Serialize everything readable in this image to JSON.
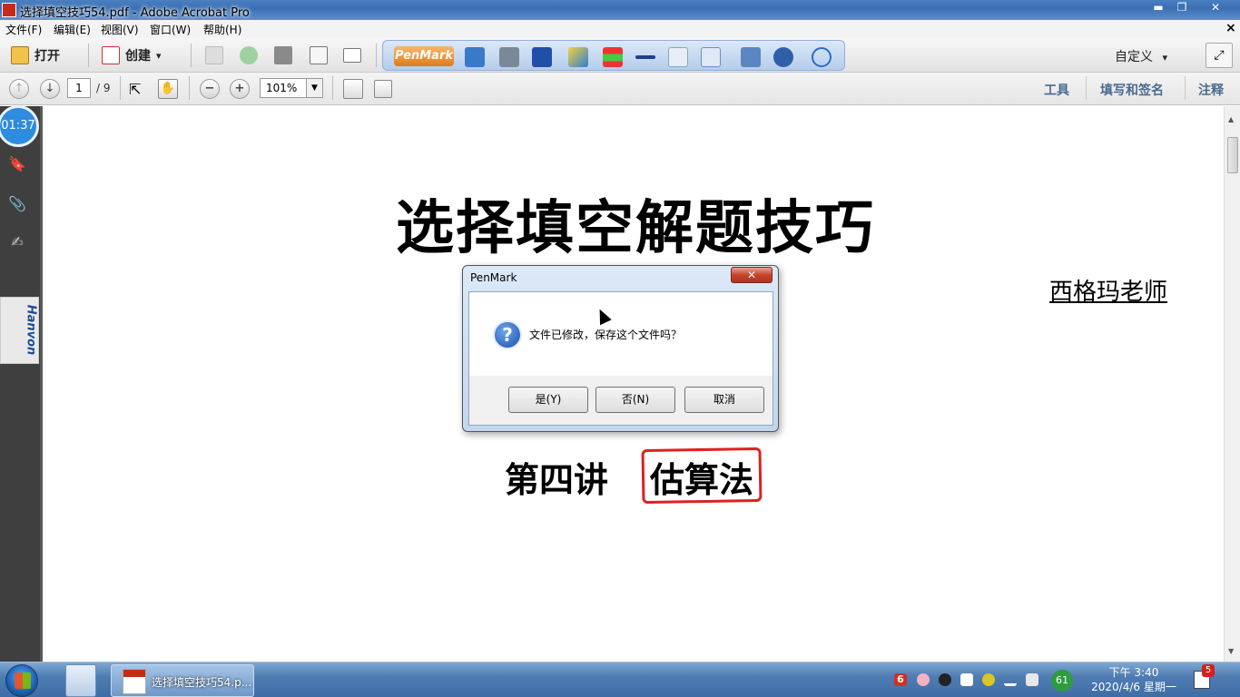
{
  "window": {
    "title": "选择填空技巧54.pdf - Adobe Acrobat Pro",
    "min_glyph": "▬",
    "max_glyph": "❐",
    "close_glyph": "✕"
  },
  "menu": {
    "items": [
      "文件(F)",
      "编辑(E)",
      "视图(V)",
      "窗口(W)",
      "帮助(H)"
    ],
    "close_glyph": "×"
  },
  "toolbar": {
    "open_label": "打开",
    "create_label": "创建",
    "create_arrow": "▾",
    "penmark_logo": "PenMark",
    "customize_label": "自定义",
    "customize_arrow": "▾",
    "expand_glyph": "⤢"
  },
  "navbar": {
    "prev_glyph": "↑",
    "next_glyph": "↓",
    "page_current": "1",
    "page_total": "/ 9",
    "zoom_out_glyph": "−",
    "zoom_in_glyph": "+",
    "zoom_value": "101%",
    "zoom_arrow": "▼",
    "select_glyph": "⇱",
    "hand_glyph": "✋",
    "tools_label": "工具",
    "fill_sign_label": "填写和签名",
    "comment_label": "注释"
  },
  "sidebar": {
    "timer": "01:37",
    "hanvon_label": "Hanvon",
    "bookmark_glyph": "🔖",
    "attach_glyph": "📎",
    "sign_glyph": "✍"
  },
  "document": {
    "title": "选择填空解题技巧",
    "teacher": "西格玛老师",
    "lecture": "第四讲",
    "topic": "估算法"
  },
  "dialog": {
    "title": "PenMark",
    "close_glyph": "✕",
    "icon_glyph": "?",
    "message": "文件已修改，保存这个文件吗？",
    "yes_label": "是(Y)",
    "no_label": "否(N)",
    "cancel_label": "取消"
  },
  "scrollbar": {
    "up_glyph": "▲",
    "down_glyph": "▼"
  },
  "taskbar": {
    "active_app_label": "选择填空技巧54.p...",
    "clock_time": "下午 3:40",
    "clock_date": "2020/4/6 星期一",
    "battery_value": "61",
    "notification_count": "5",
    "tray_6": "6"
  }
}
